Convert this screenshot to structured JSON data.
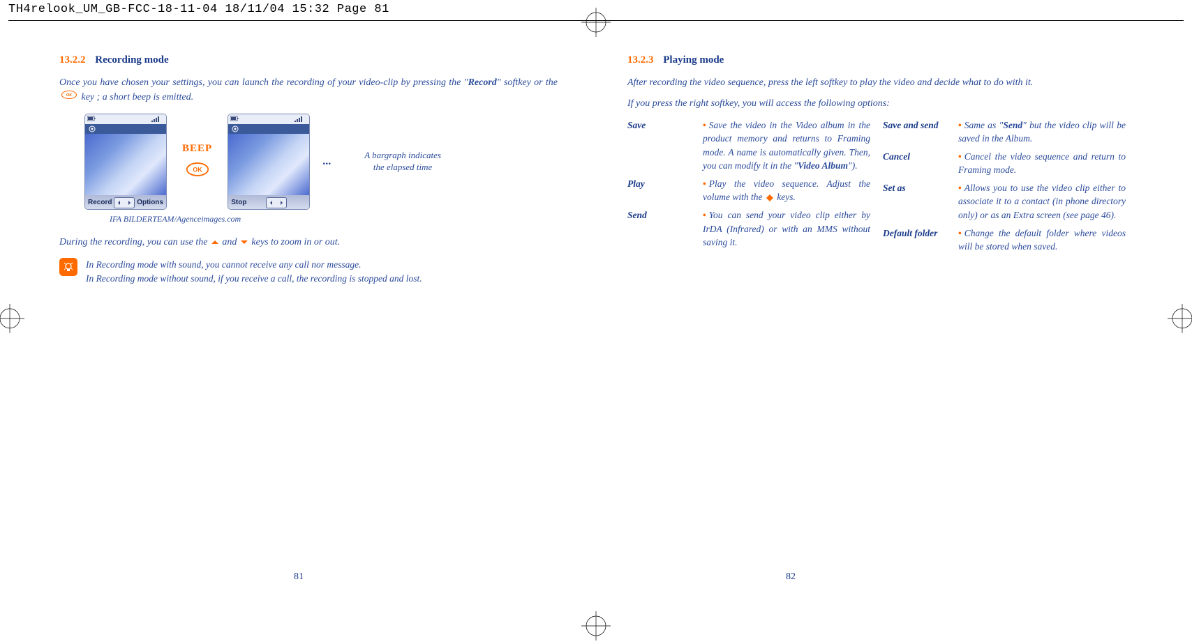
{
  "header": "TH4relook_UM_GB-FCC-18-11-04  18/11/04  15:32  Page 81",
  "left": {
    "section_num": "13.2.2",
    "section_title": "Recording mode",
    "intro_a": "Once you have chosen your settings, you can launch the recording of your video-clip by pressing the \"",
    "intro_b": "Record",
    "intro_c": "\" softkey or the ",
    "intro_d": " key ; a short beep is emitted.",
    "beep": "BEEP",
    "dots": "...",
    "bargraph_a": "A bargraph indicates",
    "bargraph_b": "the elapsed time",
    "soft_record": "Record",
    "soft_options": "Options",
    "soft_stop": "Stop",
    "credit": "IFA BILDERTEAM/Agenceimages.com",
    "zoom_a": "During the recording, you can use the ",
    "zoom_b": " and ",
    "zoom_c": " keys to zoom in or out.",
    "note1": "In Recording mode with sound, you cannot receive any call nor message.",
    "note2": "In Recording mode without sound, if you receive a call, the recording is stopped and lost.",
    "page_num": "81"
  },
  "right": {
    "section_num": "13.2.3",
    "section_title": "Playing mode",
    "intro": "After recording the video sequence, press the left softkey to play the video and decide what to do with it.",
    "intro2": "If you press the right softkey, you will access the following options:",
    "col1": {
      "save_label": "Save",
      "save_desc_a": "Save the video in the Video album in the product memory and returns to Framing mode. A name is automatically given. Then, you can modify it in the \"",
      "save_desc_b": "Video Album",
      "save_desc_c": "\").",
      "play_label": "Play",
      "play_desc_a": "Play the video sequence. Adjust the volume with the ",
      "play_desc_b": " keys.",
      "send_label": "Send",
      "send_desc": "You can send your video clip either by IrDA (Infrared) or with an MMS without saving it."
    },
    "col2": {
      "ss_label": "Save and send",
      "ss_desc_a": "Same as \"",
      "ss_desc_b": "Send",
      "ss_desc_c": "\" but the video clip will be saved in the Album.",
      "cancel_label": "Cancel",
      "cancel_desc": "Cancel the video sequence and return to Framing mode.",
      "setas_label": "Set as",
      "setas_desc": "Allows you to use the video clip either to associate it to a contact (in phone directory only) or as an Extra screen (see page 46).",
      "df_label": "Default folder",
      "df_desc": "Change the default folder where videos will be stored when saved."
    },
    "page_num": "82"
  }
}
